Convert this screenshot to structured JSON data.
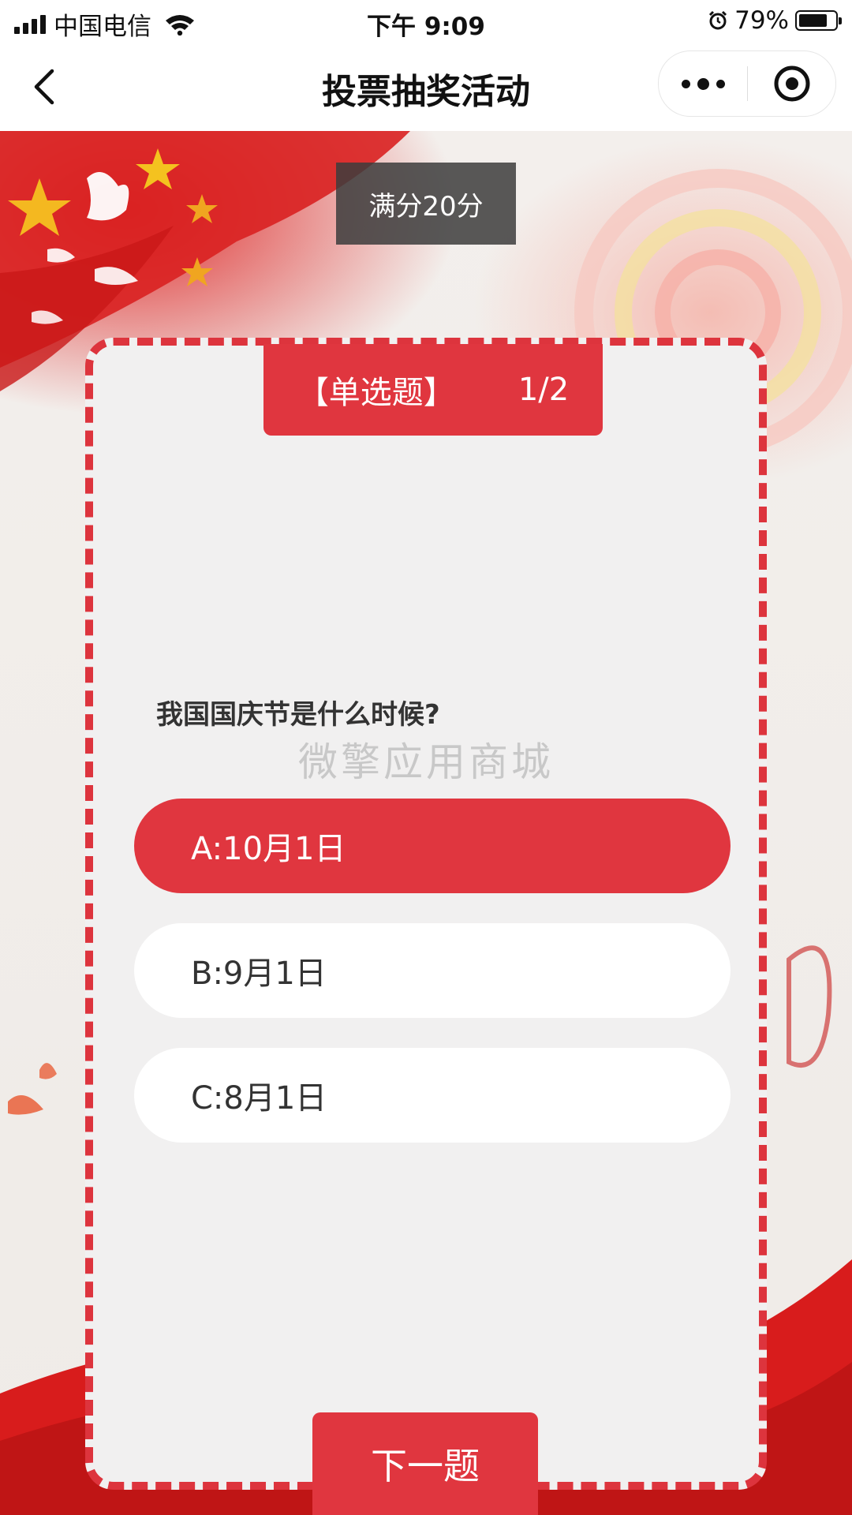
{
  "status_bar": {
    "carrier": "中国电信",
    "time": "下午 9:09",
    "battery": "79%",
    "battery_level": 0.79
  },
  "nav": {
    "title": "投票抽奖活动"
  },
  "score": {
    "label": "满分20分"
  },
  "question_card": {
    "type": "【单选题】",
    "progress": "1/2",
    "question": "我国国庆节是什么时候?",
    "options": [
      {
        "label": "A:10月1日",
        "selected": true
      },
      {
        "label": "B:9月1日",
        "selected": false
      },
      {
        "label": "C:8月1日",
        "selected": false
      }
    ]
  },
  "watermark": "微擎应用商城",
  "next_button": {
    "label": "下一题"
  },
  "colors": {
    "accent": "#e0363f",
    "badge_bg": "#3c3c3c",
    "card_bg": "#f1f0f0"
  },
  "icons": {
    "back": "chevron-left-icon",
    "more": "more-dots-icon",
    "close": "target-close-icon",
    "wifi": "wifi-icon",
    "alarm": "alarm-icon",
    "battery": "battery-icon"
  }
}
